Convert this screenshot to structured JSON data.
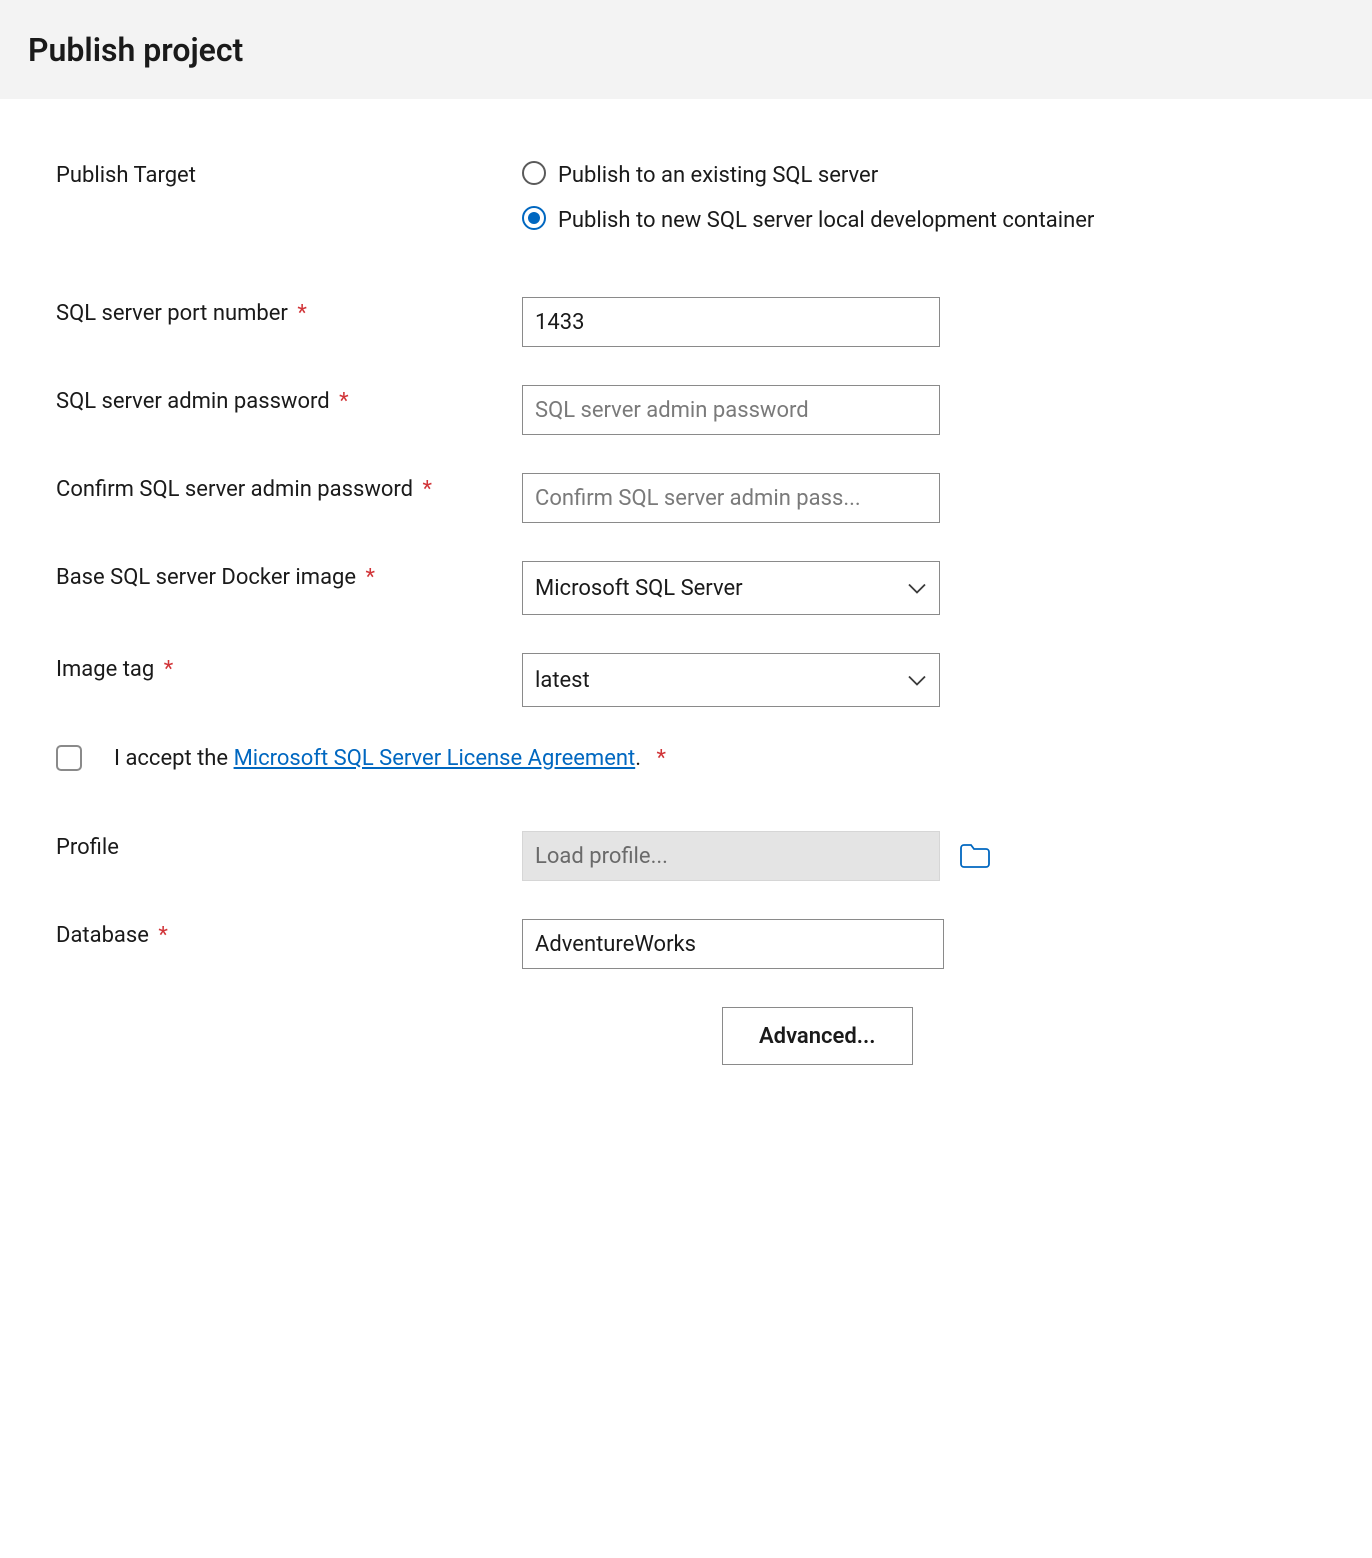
{
  "header": {
    "title": "Publish project"
  },
  "form": {
    "publish_target": {
      "label": "Publish Target",
      "options": [
        {
          "label": "Publish to an existing SQL server",
          "selected": false
        },
        {
          "label": "Publish to new SQL server local development container",
          "selected": true
        }
      ]
    },
    "port": {
      "label": "SQL server port number",
      "value": "1433"
    },
    "admin_password": {
      "label": "SQL server admin password",
      "placeholder": "SQL server admin password"
    },
    "confirm_password": {
      "label": "Confirm SQL server admin password",
      "placeholder": "Confirm SQL server admin pass..."
    },
    "docker_image": {
      "label": "Base SQL server Docker image",
      "selected": "Microsoft SQL Server"
    },
    "image_tag": {
      "label": "Image tag",
      "selected": "latest"
    },
    "license": {
      "prefix": "I accept the ",
      "link_text": "Microsoft SQL Server License Agreement",
      "suffix": "."
    },
    "profile": {
      "label": "Profile",
      "placeholder": "Load profile..."
    },
    "database": {
      "label": "Database",
      "value": "AdventureWorks"
    },
    "advanced_button": "Advanced..."
  },
  "required_marker": "*"
}
